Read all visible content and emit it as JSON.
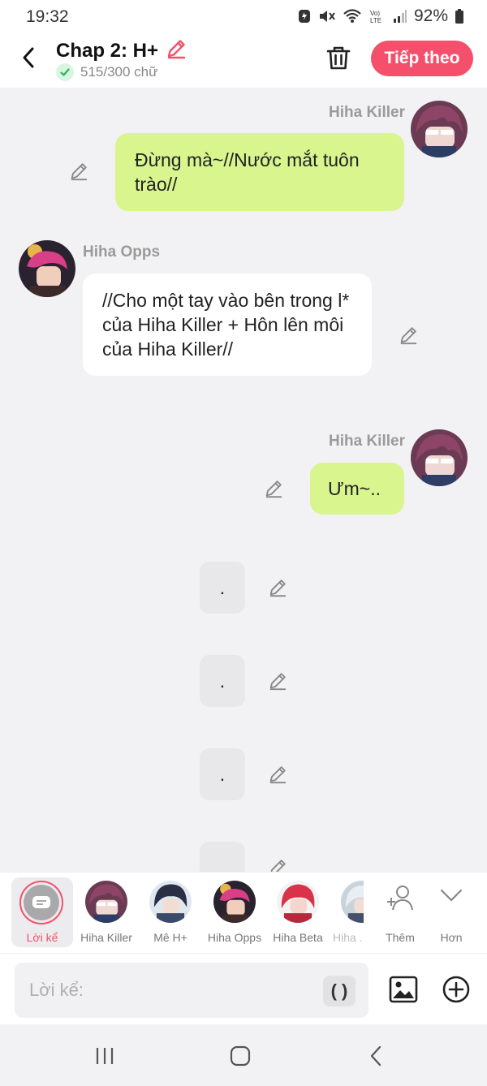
{
  "status": {
    "time": "19:32",
    "battery": "92%"
  },
  "header": {
    "title": "Chap 2: H+",
    "word_count": "515/300 chữ",
    "next_label": "Tiếp theo"
  },
  "messages": [
    {
      "speaker": "Hiha Killer",
      "text": "Đừng mà~//Nước mắt tuôn trào//"
    },
    {
      "speaker": "Hiha Opps",
      "text": "//Cho một tay vào bên trong l* của Hiha Killer + Hôn lên môi của Hiha Killer//"
    },
    {
      "speaker": "Hiha Killer",
      "text": "Ưm~.."
    },
    {
      "text": "."
    },
    {
      "text": "."
    },
    {
      "text": "."
    },
    {
      "text": "."
    }
  ],
  "characters": [
    {
      "label": "Lời kể"
    },
    {
      "label": "Hiha Killer"
    },
    {
      "label": "Mê H+"
    },
    {
      "label": "Hiha Opps"
    },
    {
      "label": "Hiha Beta"
    },
    {
      "label": "Hiha ..."
    },
    {
      "label": "Thêm"
    },
    {
      "label": "Hơn"
    }
  ],
  "composer": {
    "placeholder": "Lời kể:",
    "paren_label": "( )"
  },
  "colors": {
    "accent": "#f4506b",
    "bubble_green": "#d8f58e",
    "bubble_white": "#ffffff",
    "bubble_gray": "#e8e8ea"
  }
}
